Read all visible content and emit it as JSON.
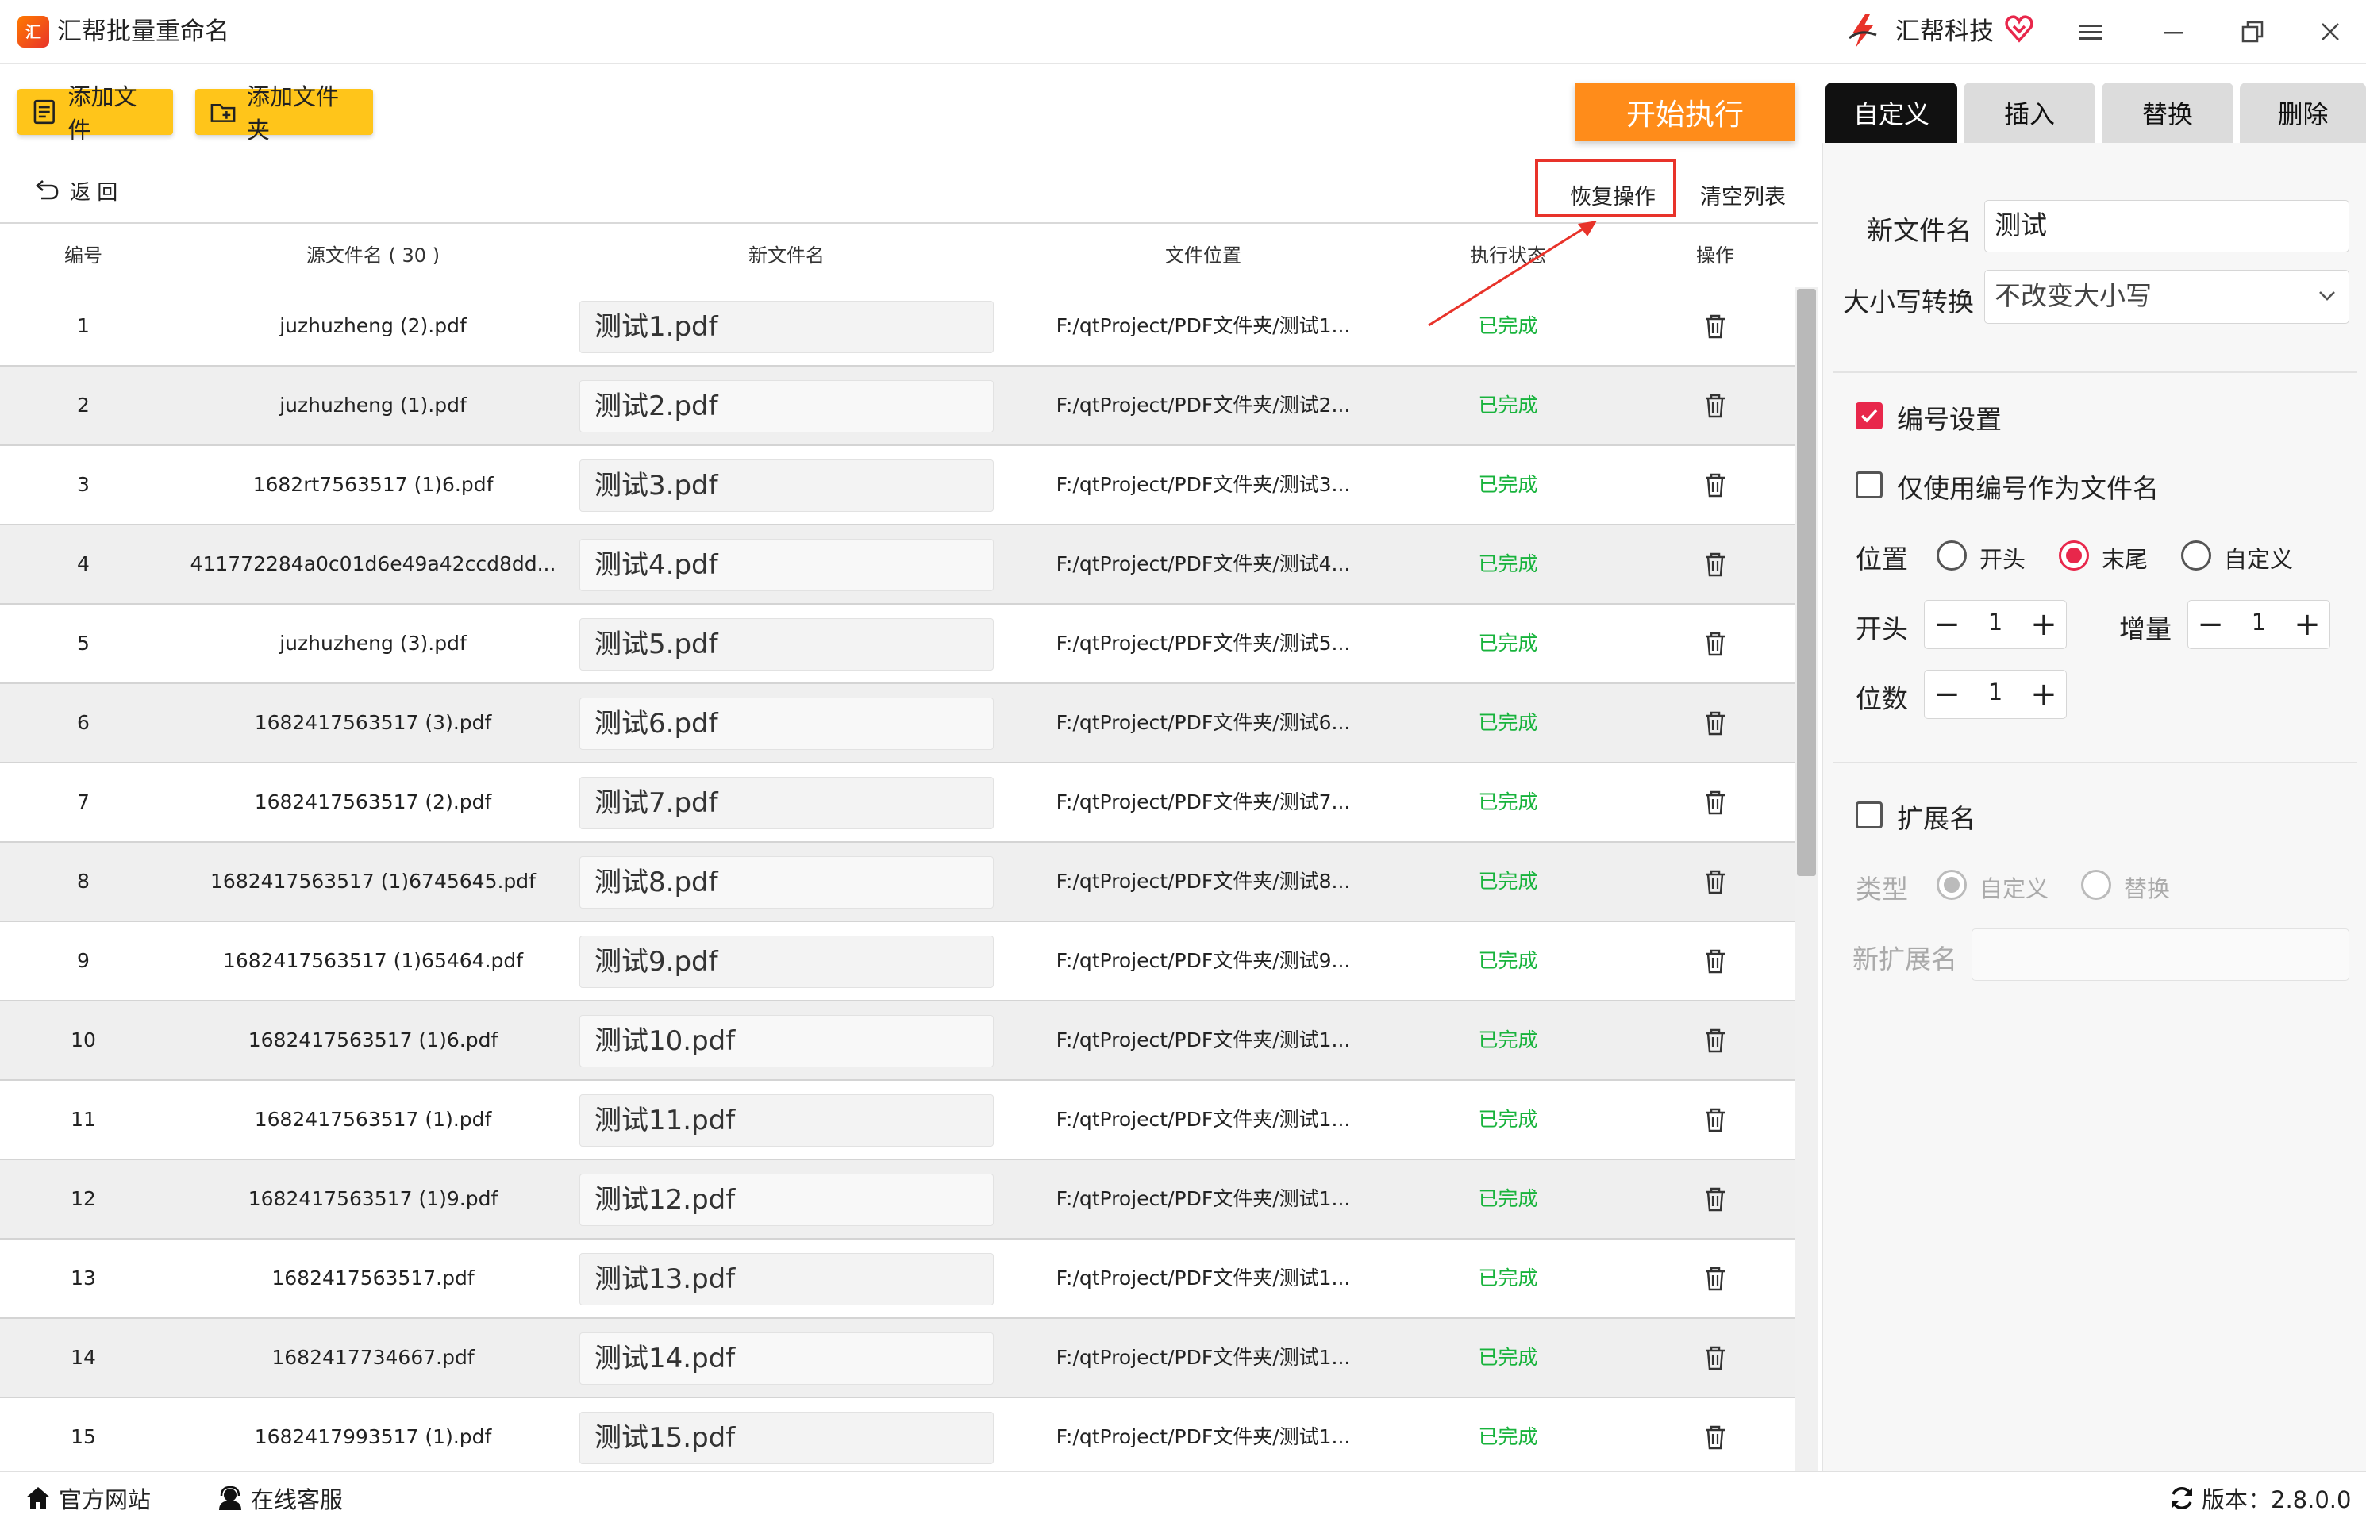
{
  "app": {
    "title": "汇帮批量重命名",
    "logo_text": "汇"
  },
  "brand": {
    "name": "汇帮科技"
  },
  "toolbar": {
    "add_file": "添加文件",
    "add_folder": "添加文件夹",
    "start": "开始执行",
    "back": "返 回",
    "restore": "恢复操作",
    "clear": "清空列表"
  },
  "tabs": [
    {
      "label": "自定义",
      "active": true
    },
    {
      "label": "插入",
      "active": false
    },
    {
      "label": "替换",
      "active": false
    },
    {
      "label": "删除",
      "active": false
    }
  ],
  "table": {
    "headers": [
      "编号",
      "源文件名 ( 30 )",
      "新文件名",
      "文件位置",
      "执行状态",
      "操作"
    ],
    "rows": [
      {
        "num": "1",
        "src": "juzhuzheng (2).pdf",
        "new": "测试1.pdf",
        "path": "F:/qtProject/PDF文件夹/测试1...",
        "status": "已完成"
      },
      {
        "num": "2",
        "src": "juzhuzheng (1).pdf",
        "new": "测试2.pdf",
        "path": "F:/qtProject/PDF文件夹/测试2...",
        "status": "已完成"
      },
      {
        "num": "3",
        "src": "1682rt7563517 (1)6.pdf",
        "new": "测试3.pdf",
        "path": "F:/qtProject/PDF文件夹/测试3...",
        "status": "已完成"
      },
      {
        "num": "4",
        "src": "411772284a0c01d6e49a42ccd8dd...",
        "new": "测试4.pdf",
        "path": "F:/qtProject/PDF文件夹/测试4...",
        "status": "已完成"
      },
      {
        "num": "5",
        "src": "juzhuzheng (3).pdf",
        "new": "测试5.pdf",
        "path": "F:/qtProject/PDF文件夹/测试5...",
        "status": "已完成"
      },
      {
        "num": "6",
        "src": "1682417563517 (3).pdf",
        "new": "测试6.pdf",
        "path": "F:/qtProject/PDF文件夹/测试6...",
        "status": "已完成"
      },
      {
        "num": "7",
        "src": "1682417563517 (2).pdf",
        "new": "测试7.pdf",
        "path": "F:/qtProject/PDF文件夹/测试7...",
        "status": "已完成"
      },
      {
        "num": "8",
        "src": "1682417563517 (1)6745645.pdf",
        "new": "测试8.pdf",
        "path": "F:/qtProject/PDF文件夹/测试8...",
        "status": "已完成"
      },
      {
        "num": "9",
        "src": "1682417563517 (1)65464.pdf",
        "new": "测试9.pdf",
        "path": "F:/qtProject/PDF文件夹/测试9...",
        "status": "已完成"
      },
      {
        "num": "10",
        "src": "1682417563517 (1)6.pdf",
        "new": "测试10.pdf",
        "path": "F:/qtProject/PDF文件夹/测试1...",
        "status": "已完成"
      },
      {
        "num": "11",
        "src": "1682417563517 (1).pdf",
        "new": "测试11.pdf",
        "path": "F:/qtProject/PDF文件夹/测试1...",
        "status": "已完成"
      },
      {
        "num": "12",
        "src": "1682417563517 (1)9.pdf",
        "new": "测试12.pdf",
        "path": "F:/qtProject/PDF文件夹/测试1...",
        "status": "已完成"
      },
      {
        "num": "13",
        "src": "1682417563517.pdf",
        "new": "测试13.pdf",
        "path": "F:/qtProject/PDF文件夹/测试1...",
        "status": "已完成"
      },
      {
        "num": "14",
        "src": "1682417734667.pdf",
        "new": "测试14.pdf",
        "path": "F:/qtProject/PDF文件夹/测试1...",
        "status": "已完成"
      },
      {
        "num": "15",
        "src": "1682417993517 (1).pdf",
        "new": "测试15.pdf",
        "path": "F:/qtProject/PDF文件夹/测试1...",
        "status": "已完成"
      }
    ]
  },
  "panel": {
    "new_name_label": "新文件名",
    "new_name_value": "测试",
    "case_label": "大小写转换",
    "case_value": "不改变大小写",
    "numbering_label": "编号设置",
    "numbering_checked": true,
    "only_number_label": "仅使用编号作为文件名",
    "only_number_checked": false,
    "position_label": "位置",
    "position_options": [
      "开头",
      "末尾",
      "自定义"
    ],
    "position_selected": "末尾",
    "start_label": "开头",
    "start_value": "1",
    "increment_label": "增量",
    "increment_value": "1",
    "digits_label": "位数",
    "digits_value": "1",
    "ext_label": "扩展名",
    "ext_checked": false,
    "type_label": "类型",
    "type_options": [
      "自定义",
      "替换"
    ],
    "type_selected": "自定义",
    "new_ext_label": "新扩展名",
    "new_ext_value": ""
  },
  "footer": {
    "website": "官方网站",
    "support": "在线客服",
    "version": "版本：2.8.0.0"
  },
  "colors": {
    "accent": "#e8274b",
    "start_button": "#ff8c1a",
    "add_button": "#ffc51a",
    "status_done": "#18b33c",
    "annotation": "#e8332a"
  }
}
